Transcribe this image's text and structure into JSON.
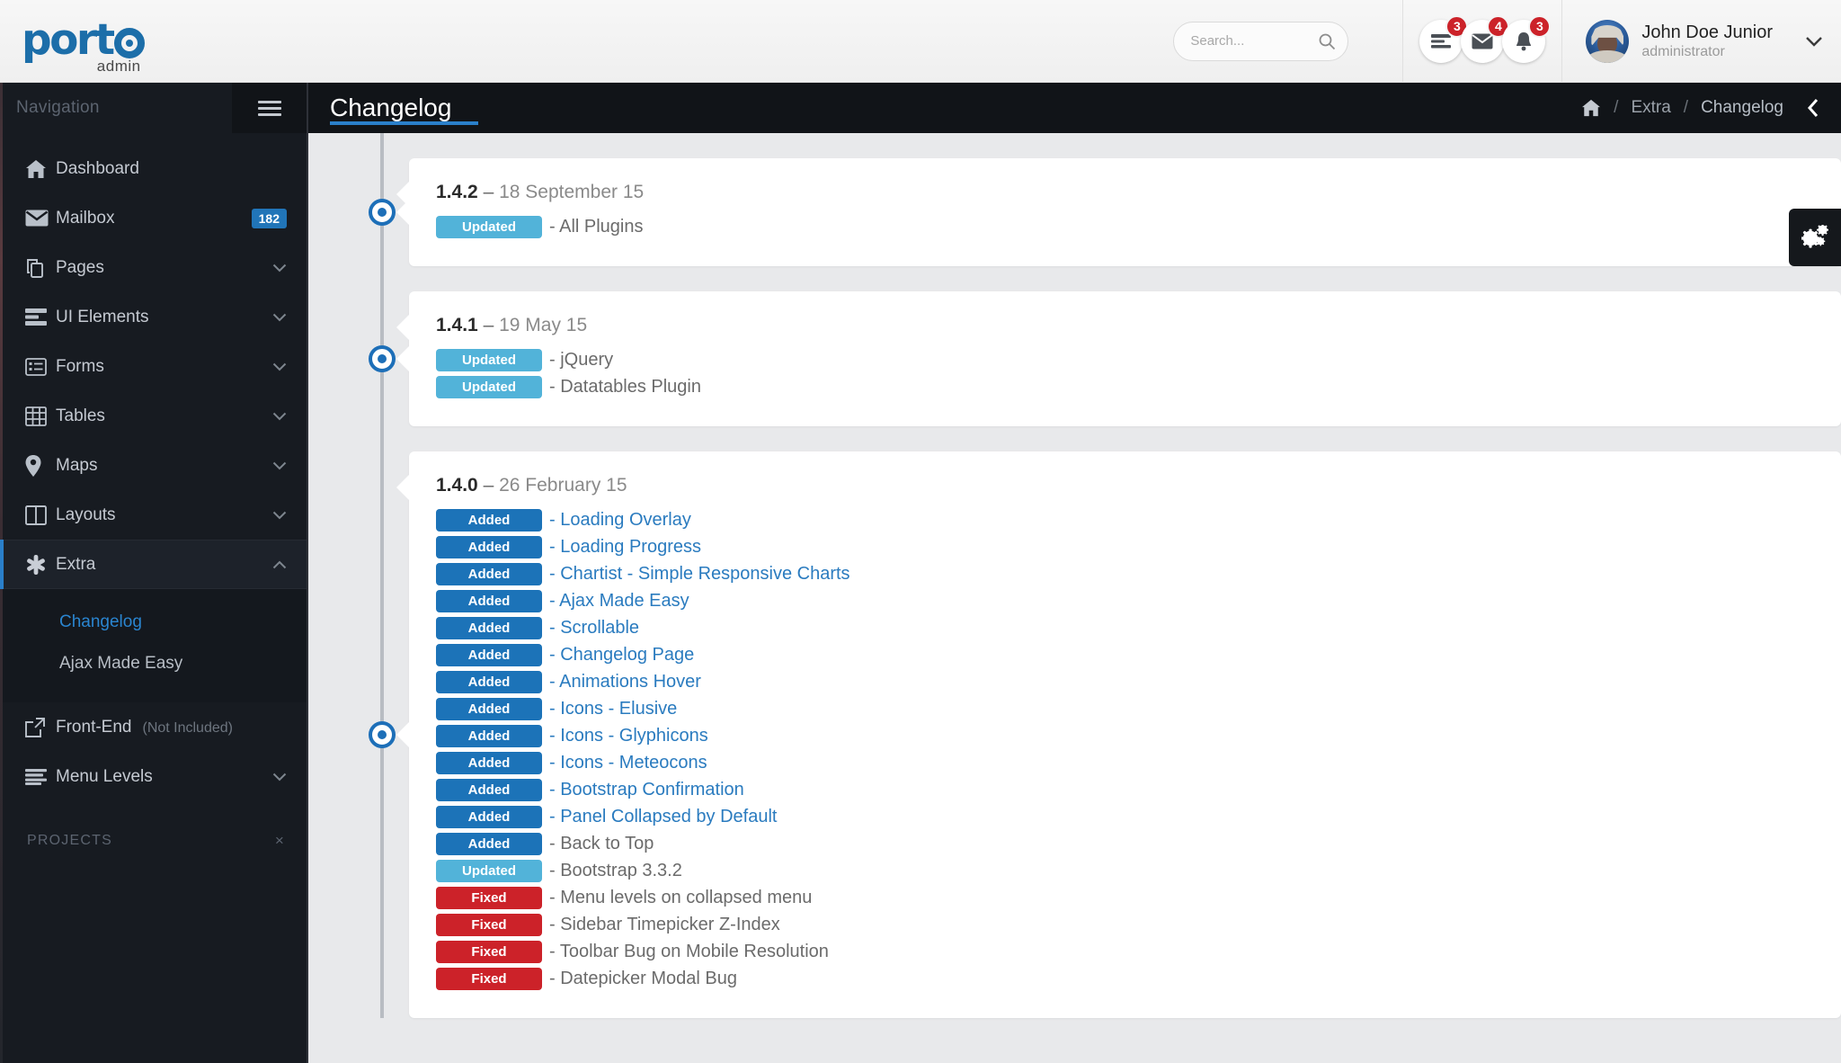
{
  "header": {
    "logo_text": "port",
    "logo_o": "o",
    "logo_sub": "admin",
    "search_placeholder": "Search...",
    "search_value": "",
    "search_icon": "search-icon",
    "notifications": [
      {
        "icon": "tasks-icon",
        "count": "3"
      },
      {
        "icon": "envelope-icon",
        "count": "4"
      },
      {
        "icon": "bell-icon",
        "count": "3"
      }
    ],
    "user": {
      "name": "John Doe Junior",
      "role": "administrator",
      "caret": "⌄"
    }
  },
  "sidebar": {
    "title": "Navigation",
    "hamburger_icon": "hamburger-icon",
    "items": [
      {
        "label": "Dashboard",
        "icon": "home-icon",
        "badge": null,
        "chevron": null,
        "active": false
      },
      {
        "label": "Mailbox",
        "icon": "envelope-icon",
        "badge": "182",
        "chevron": null,
        "active": false
      },
      {
        "label": "Pages",
        "icon": "pages-icon",
        "badge": null,
        "chevron": "down",
        "active": false
      },
      {
        "label": "UI Elements",
        "icon": "ui-icon",
        "badge": null,
        "chevron": "down",
        "active": false
      },
      {
        "label": "Forms",
        "icon": "forms-icon",
        "badge": null,
        "chevron": "down",
        "active": false
      },
      {
        "label": "Tables",
        "icon": "table-icon",
        "badge": null,
        "chevron": "down",
        "active": false
      },
      {
        "label": "Maps",
        "icon": "map-pin-icon",
        "badge": null,
        "chevron": "down",
        "active": false
      },
      {
        "label": "Layouts",
        "icon": "layout-icon",
        "badge": null,
        "chevron": "down",
        "active": false
      },
      {
        "label": "Extra",
        "icon": "asterisk-icon",
        "badge": null,
        "chevron": "up",
        "active": true
      }
    ],
    "sub_items": [
      {
        "label": "Changelog",
        "current": true
      },
      {
        "label": "Ajax Made Easy",
        "current": false
      }
    ],
    "items_after": [
      {
        "label": "Front-End",
        "note": "(Not Included)",
        "icon": "external-link-icon",
        "chevron": null
      },
      {
        "label": "Menu Levels",
        "note": null,
        "icon": "menu-levels-icon",
        "chevron": "down"
      }
    ],
    "projects_label": "PROJECTS",
    "projects_close": "×"
  },
  "page": {
    "title": "Changelog",
    "breadcrumb": {
      "home_icon": "home-icon",
      "sep": "/",
      "items": [
        "Extra",
        "Changelog"
      ]
    },
    "collapse_icon": "chevron-left-icon",
    "gear_icon": "gears-icon"
  },
  "changelog": [
    {
      "version": "1.4.2",
      "dash": "–",
      "date": "18 September 15",
      "rows": [
        {
          "tag": "Updated",
          "type": "updated",
          "text": "- All Plugins",
          "link": false
        }
      ]
    },
    {
      "version": "1.4.1",
      "dash": "–",
      "date": "19 May 15",
      "rows": [
        {
          "tag": "Updated",
          "type": "updated",
          "text": "- jQuery",
          "link": false
        },
        {
          "tag": "Updated",
          "type": "updated",
          "text": "- Datatables Plugin",
          "link": false
        }
      ]
    },
    {
      "version": "1.4.0",
      "dash": "–",
      "date": "26 February 15",
      "rows": [
        {
          "tag": "Added",
          "type": "added",
          "text": "- Loading Overlay",
          "link": true
        },
        {
          "tag": "Added",
          "type": "added",
          "text": "- Loading Progress",
          "link": true
        },
        {
          "tag": "Added",
          "type": "added",
          "text": "- Chartist - Simple Responsive Charts",
          "link": true
        },
        {
          "tag": "Added",
          "type": "added",
          "text": "- Ajax Made Easy",
          "link": true
        },
        {
          "tag": "Added",
          "type": "added",
          "text": "- Scrollable",
          "link": true
        },
        {
          "tag": "Added",
          "type": "added",
          "text": "- Changelog Page",
          "link": true
        },
        {
          "tag": "Added",
          "type": "added",
          "text": "- Animations Hover",
          "link": true
        },
        {
          "tag": "Added",
          "type": "added",
          "text": "- Icons - Elusive",
          "link": true
        },
        {
          "tag": "Added",
          "type": "added",
          "text": "- Icons - Glyphicons",
          "link": true
        },
        {
          "tag": "Added",
          "type": "added",
          "text": "- Icons - Meteocons",
          "link": true
        },
        {
          "tag": "Added",
          "type": "added",
          "text": "- Bootstrap Confirmation",
          "link": true
        },
        {
          "tag": "Added",
          "type": "added",
          "text": "- Panel Collapsed by Default",
          "link": true
        },
        {
          "tag": "Added",
          "type": "added",
          "text": "- Back to Top",
          "link": false
        },
        {
          "tag": "Updated",
          "type": "updated",
          "text": "- Bootstrap 3.3.2",
          "link": false
        },
        {
          "tag": "Fixed",
          "type": "fixed",
          "text": "- Menu levels on collapsed menu",
          "link": false
        },
        {
          "tag": "Fixed",
          "type": "fixed",
          "text": "- Sidebar Timepicker Z-Index",
          "link": false
        },
        {
          "tag": "Fixed",
          "type": "fixed",
          "text": "- Toolbar Bug on Mobile Resolution",
          "link": false
        },
        {
          "tag": "Fixed",
          "type": "fixed",
          "text": "- Datepicker Modal Bug",
          "link": false
        }
      ]
    }
  ],
  "colors": {
    "accent": "#2a7fc9",
    "added": "#1c73b8",
    "updated": "#52b3d9",
    "fixed": "#cc2229",
    "sidebar_bg": "#171b21",
    "badge_red": "#cc2229"
  }
}
